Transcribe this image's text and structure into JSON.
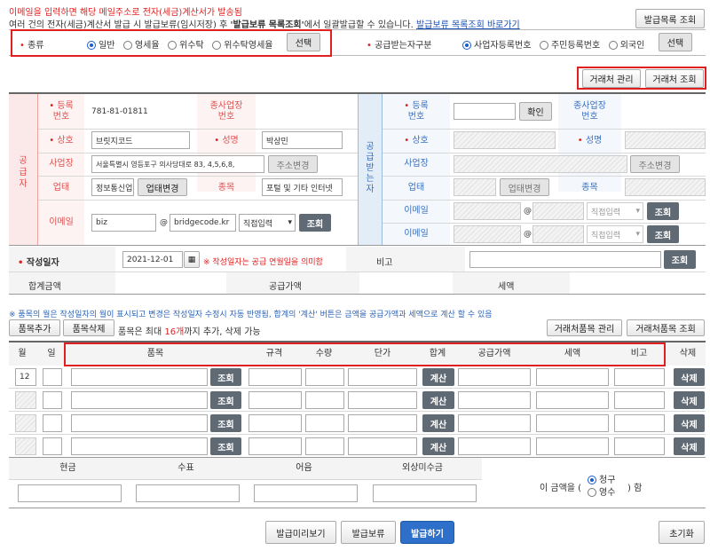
{
  "notice": {
    "line1": "이메일을 입력하면 해당 메일주소로 전자(세금)계산서가 발송됨",
    "line2_a": "여러 건의 전자(세금)계산서 발급 시 발급보류(임시저장) 후 ",
    "line2_b": "'발급보류 목록조회'",
    "line2_c": "에서 일괄발급할 수 있습니다. ",
    "line2_link": "발급보류 목록조회 바로가기"
  },
  "top_btn": "발급목록 조회",
  "type_row": {
    "label": "종류",
    "options": [
      "일반",
      "영세율",
      "위수탁",
      "위수탁영세율"
    ],
    "selected": 0,
    "select_btn": "선택"
  },
  "recv_row": {
    "label": "공급받는자구분",
    "options": [
      "사업자등록번호",
      "주민등록번호",
      "외국인"
    ],
    "selected": 0,
    "select_btn": "선택"
  },
  "partner": {
    "manage": "거래처 관리",
    "lookup": "거래처 조회"
  },
  "supplier": {
    "side": "공급자",
    "reg_label": "등록\n번호",
    "reg_value": "781-81-01811",
    "branch_label": "종사업장\n번호",
    "name_label": "상호",
    "name_value": "브릿지코드",
    "ceo_label": "성명",
    "ceo_value": "박상민",
    "addr_label": "사업장",
    "addr_value": "서울특별시 영등포구 의사당대로 83, 4,5,6,8,",
    "addr_btn": "주소변경",
    "biz_label": "업태",
    "biz_value": "정보통신업",
    "biz_btn": "업태변경",
    "item_label": "종목",
    "item_value": "포털 및 기타 인터넷",
    "email_label": "이메일",
    "email_id": "biz",
    "at": "@",
    "email_domain": "bridgecode.kr",
    "email_select": "직접입력",
    "email_btn": "조회"
  },
  "receiver": {
    "side": "공급받는자",
    "reg_label": "등록\n번호",
    "confirm_btn": "확인",
    "branch_label": "종사업장\n번호",
    "name_label": "상호",
    "ceo_label": "성명",
    "addr_label": "사업장",
    "addr_btn": "주소변경",
    "biz_label": "업태",
    "biz_btn": "업태변경",
    "item_label": "종목",
    "email_label": "이메일",
    "at": "@",
    "email_select": "직접입력",
    "email_btn": "조회"
  },
  "date_row": {
    "label": "작성일자",
    "value": "2021-12-01",
    "note": "※ 작성일자는 공급 연월일을 의미함",
    "memo_label": "비고",
    "memo_btn": "조회"
  },
  "total_row": {
    "total": "합계금액",
    "supply": "공급가액",
    "tax": "세액"
  },
  "item_notice": "※ 품목의 월은 작성일자의 월이 표시되고 변경은 작성일자 수정시 자동 반영됨, 합계의 '계산' 버튼은 금액을 공급가액과 세액으로 계산 할 수 있음",
  "item_tools": {
    "add": "품목추가",
    "del": "품목삭제",
    "note_a": "품목은 최대 ",
    "note_b": "16개",
    "note_c": "까지 추가, 삭제 가능",
    "manage": "거래처품목 관리",
    "lookup": "거래처품목 조회"
  },
  "item_headers": {
    "month": "월",
    "day": "일",
    "item": "품목",
    "spec": "규격",
    "qty": "수량",
    "price": "단가",
    "sum": "합계",
    "supply": "공급가액",
    "tax": "세액",
    "memo": "비고",
    "del": "삭제"
  },
  "item_rows": [
    {
      "month": "12"
    },
    {
      "month": ""
    },
    {
      "month": ""
    },
    {
      "month": ""
    }
  ],
  "row_btns": {
    "lookup": "조회",
    "calc": "계산",
    "del": "삭제"
  },
  "pay": {
    "cash": "현금",
    "check": "수표",
    "note": "어음",
    "credit": "외상미수금",
    "claim_a": "이 금액을 (",
    "claim_b": ") 함",
    "opt1": "청구",
    "opt2": "영수"
  },
  "bottom": {
    "preview": "발급미리보기",
    "hold": "발급보류",
    "issue": "발급하기",
    "reset": "초기화"
  }
}
